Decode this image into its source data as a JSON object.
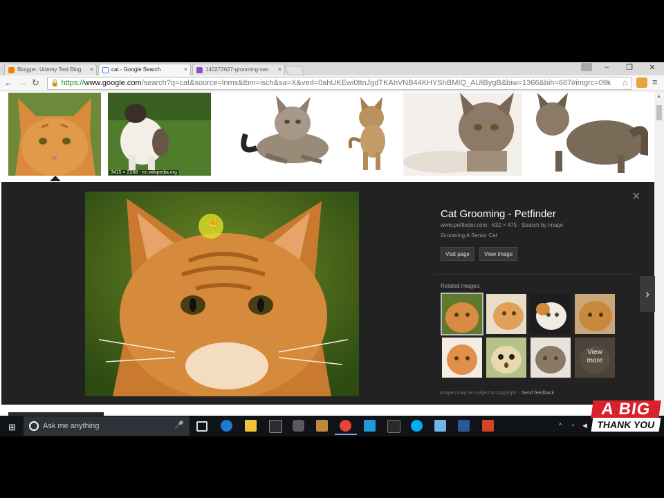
{
  "browser": {
    "tabs": [
      {
        "title": "Blogger: Udemy Test Blog",
        "icon": "blogger-icon",
        "color": "#f57d00"
      },
      {
        "title": "cat - Google Search",
        "icon": "google-icon",
        "color": "#4285f4"
      },
      {
        "title": "140272627-grooming-sen",
        "icon": "image-icon",
        "color": "#8c4fc0"
      }
    ],
    "tab_close": "×",
    "url": {
      "https": "https://",
      "host": "www.google.com",
      "path": "/search?q=cat&source=lnms&tbm=isch&sa=X&ved=0ahUKEwi0ttnJgdTKAhVNB44KHYShBMIQ_AUIBygB&biw=1366&bih=667#imgrc=09k"
    }
  },
  "results": {
    "thumbnails": [
      {
        "icon": "orange-tabby-cat-thumbnail",
        "caption": ""
      },
      {
        "icon": "siamese-cat-on-grass-thumbnail",
        "caption": "3415 × 2268 - en.wikipedia.org"
      },
      {
        "icon": "tabby-cat-lying-thumbnail",
        "caption": ""
      },
      {
        "icon": "tabby-kitten-standing-thumbnail",
        "caption": ""
      },
      {
        "icon": "tabby-cat-portrait-thumbnail",
        "caption": ""
      },
      {
        "icon": "fluffy-tabby-cat-thumbnail",
        "caption": ""
      }
    ]
  },
  "preview": {
    "title": "Cat Grooming - Petfinder",
    "meta": "www.petfinder.com - 632 × 475 - Search by image",
    "description": "Grooming A Senior Cat",
    "visit_page": "Visit page",
    "view_image": "View image",
    "related_label": "Related images:",
    "view_more_1": "View",
    "view_more_2": "more",
    "footnote": "Images may be subject to copyright.",
    "feedback": "Send feedback",
    "close": "×",
    "next": "›"
  },
  "taskbar": {
    "search_placeholder": "Ask me anything"
  },
  "watermark": {
    "line1": "A BIG",
    "line2": "THANK YOU"
  },
  "colors": {
    "panel_bg": "#222222",
    "taskbar_bg": "#101318",
    "logo_red": "#d8222b"
  }
}
